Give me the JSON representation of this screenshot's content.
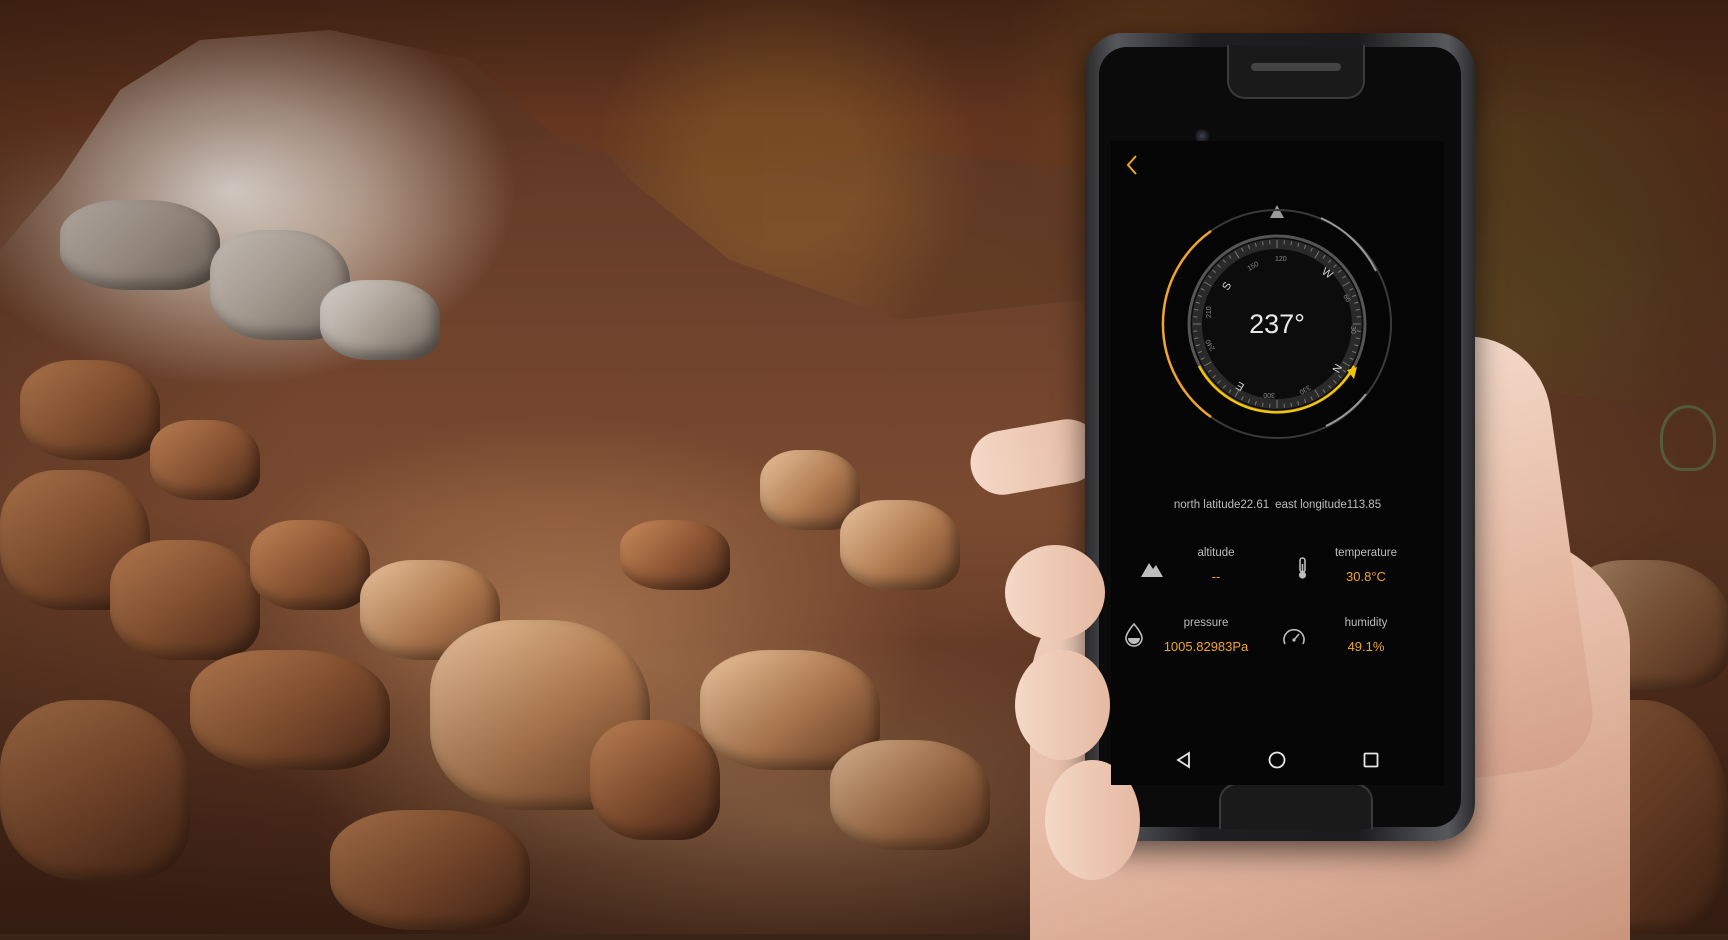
{
  "compass": {
    "heading": "237°",
    "dial_labels": {
      "n": "N",
      "e": "E",
      "s": "S",
      "w": "W",
      "d30": "30",
      "d60": "60",
      "d120": "120",
      "d150": "150",
      "d210": "210",
      "d240": "240",
      "d300": "300",
      "d330": "330"
    }
  },
  "location": {
    "latitude": "north latitude22.61",
    "longitude": "east longitude113.85"
  },
  "sensors": {
    "altitude": {
      "label": "altitude",
      "value": "--",
      "icon": "mountain-icon"
    },
    "temperature": {
      "label": "temperature",
      "value": "30.8°C",
      "icon": "thermometer-icon"
    },
    "pressure": {
      "label": "pressure",
      "value": "1005.82983Pa",
      "icon": "water-drop-icon"
    },
    "humidity": {
      "label": "humidity",
      "value": "49.1%",
      "icon": "gauge-icon"
    }
  },
  "nav": {
    "back_icon": "chevron-left-icon",
    "nav_back_icon": "triangle-back-icon",
    "home_icon": "circle-home-icon",
    "recents_icon": "square-recents-icon"
  },
  "colors": {
    "accent": "#f0a52a",
    "accent_yellow": "#f5c400",
    "screen_bg": "#050505",
    "text": "#bdbdbd"
  }
}
